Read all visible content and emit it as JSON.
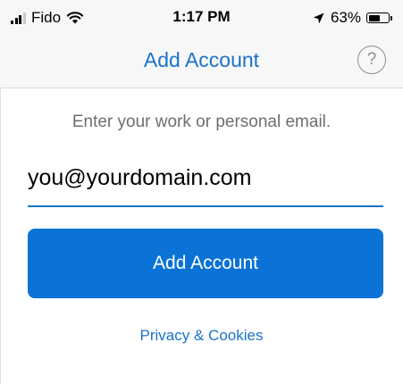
{
  "status_bar": {
    "carrier": "Fido",
    "time": "1:17 PM",
    "battery_percent": "63%",
    "battery_level": 0.63,
    "signal_bars_filled": 3,
    "signal_bars_total": 4,
    "icons": [
      "signal-icon",
      "wifi-icon",
      "location-arrow-icon",
      "battery-icon"
    ]
  },
  "nav": {
    "title": "Add Account",
    "help_glyph": "?",
    "help_icon": "question-circle-icon"
  },
  "form": {
    "prompt": "Enter your work or personal email.",
    "email_placeholder": "you@yourdomain.com",
    "email_value": "",
    "submit_label": "Add Account",
    "privacy_link": "Privacy & Cookies"
  },
  "colors": {
    "accent": "#1a73c9",
    "button": "#0b73d6",
    "bar_background": "#f7f7f8",
    "secondary_text": "#6e6e73"
  }
}
